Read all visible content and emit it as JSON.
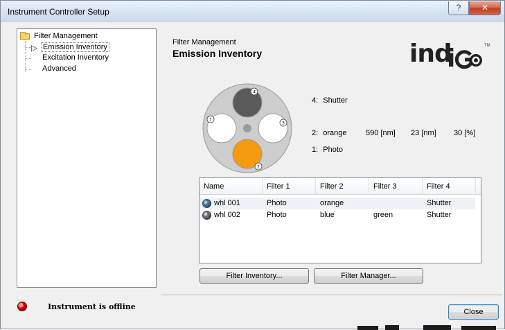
{
  "window": {
    "title": "Instrument Controller Setup",
    "help_glyph": "?",
    "close_glyph": "✕"
  },
  "tree": {
    "root": "Filter Management",
    "items": [
      {
        "label": "Emission Inventory",
        "selected": true
      },
      {
        "label": "Excitation Inventory",
        "selected": false
      },
      {
        "label": "Advanced",
        "selected": false
      }
    ]
  },
  "header": {
    "section": "Filter Management",
    "page_title": "Emission Inventory"
  },
  "logo": {
    "text_left": "ind",
    "text_right": "i",
    "tm": "TM"
  },
  "wheel": {
    "slots": [
      {
        "number": "4",
        "color": "#5a5a5a"
      },
      {
        "number": "3",
        "color": "#ffffff"
      },
      {
        "number": "2",
        "color": "#f59a10"
      },
      {
        "number": "1",
        "color": "#ffffff"
      }
    ],
    "body_color": "#cdcdcd"
  },
  "positions": [
    {
      "label": "4:",
      "name": "Shutter",
      "wavelength": "",
      "bandwidth": "",
      "transmission": ""
    },
    {
      "label": "2:",
      "name": "orange",
      "wavelength": "590 [nm]",
      "bandwidth": "23 [nm]",
      "transmission": "30 [%]"
    },
    {
      "label": "1:",
      "name": "Photo",
      "wavelength": "",
      "bandwidth": "",
      "transmission": ""
    }
  ],
  "table": {
    "columns": [
      "Name",
      "Filter 1",
      "Filter 2",
      "Filter 3",
      "Filter 4"
    ],
    "rows": [
      [
        "whl 001",
        "Photo",
        "orange",
        "",
        "Shutter"
      ],
      [
        "whl 002",
        "Photo",
        "blue",
        "green",
        "Shutter"
      ]
    ]
  },
  "buttons": {
    "filter_inventory": "Filter Inventory...",
    "filter_manager": "Filter Manager...",
    "close": "Close"
  },
  "status": {
    "text": "Instrument is offline",
    "led_color": "#e00000"
  }
}
